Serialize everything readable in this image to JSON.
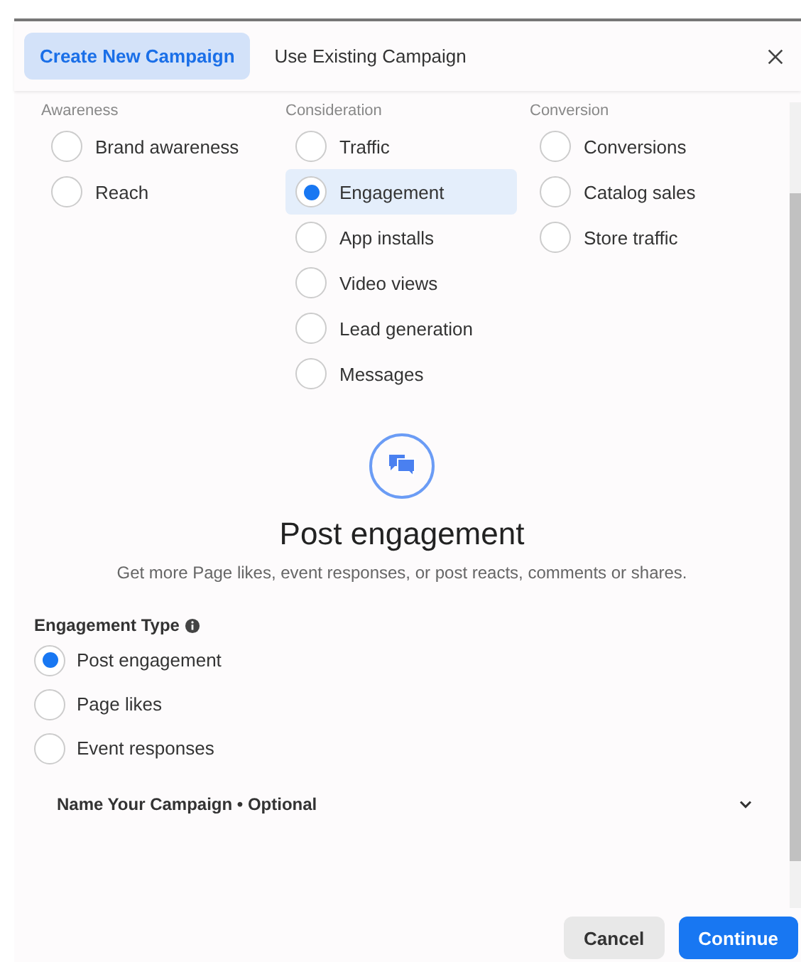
{
  "tabs": [
    {
      "label": "Create New Campaign",
      "selected": true
    },
    {
      "label": "Use Existing Campaign",
      "selected": false
    }
  ],
  "objective_columns": [
    {
      "heading": "Awareness",
      "options": [
        {
          "label": "Brand awareness",
          "selected": false
        },
        {
          "label": "Reach",
          "selected": false
        }
      ]
    },
    {
      "heading": "Consideration",
      "options": [
        {
          "label": "Traffic",
          "selected": false
        },
        {
          "label": "Engagement",
          "selected": true
        },
        {
          "label": "App installs",
          "selected": false
        },
        {
          "label": "Video views",
          "selected": false
        },
        {
          "label": "Lead generation",
          "selected": false
        },
        {
          "label": "Messages",
          "selected": false
        }
      ]
    },
    {
      "heading": "Conversion",
      "options": [
        {
          "label": "Conversions",
          "selected": false
        },
        {
          "label": "Catalog sales",
          "selected": false
        },
        {
          "label": "Store traffic",
          "selected": false
        }
      ]
    }
  ],
  "objective_detail": {
    "title": "Post engagement",
    "description": "Get more Page likes, event responses, or post reacts, comments or shares."
  },
  "engagement_type": {
    "label": "Engagement Type",
    "options": [
      {
        "label": "Post engagement",
        "selected": true
      },
      {
        "label": "Page likes",
        "selected": false
      },
      {
        "label": "Event responses",
        "selected": false
      }
    ]
  },
  "name_campaign": {
    "label": "Name Your Campaign • Optional",
    "expanded": false
  },
  "buttons": [
    {
      "label": "Cancel",
      "kind": "secondary"
    },
    {
      "label": "Continue",
      "kind": "primary"
    }
  ]
}
